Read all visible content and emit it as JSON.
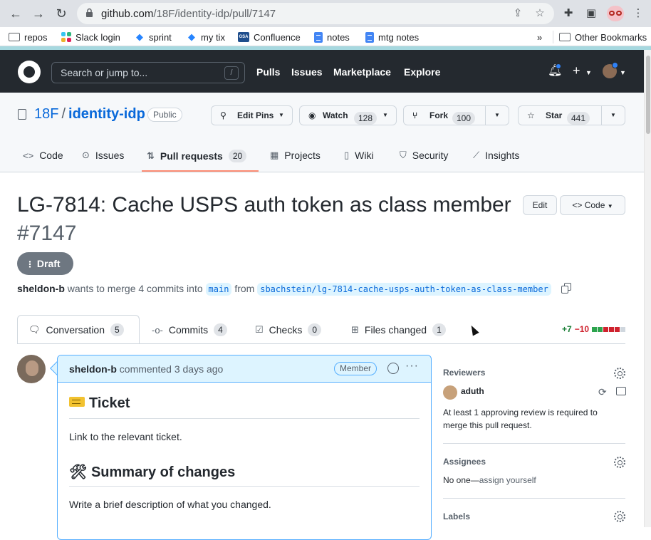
{
  "browser": {
    "url_host": "github.com",
    "url_path": "/18F/identity-idp/pull/7147",
    "bookmarks": [
      {
        "label": "repos",
        "icon": "folder-icon"
      },
      {
        "label": "Slack login",
        "icon": "slack-icon"
      },
      {
        "label": "sprint",
        "icon": "jira-icon"
      },
      {
        "label": "my tix",
        "icon": "jira-icon"
      },
      {
        "label": "Confluence",
        "icon": "gsa-icon"
      },
      {
        "label": "notes",
        "icon": "doc-icon"
      },
      {
        "label": "mtg notes",
        "icon": "doc-icon"
      }
    ],
    "overflow": "»",
    "other_bookmarks": "Other Bookmarks"
  },
  "github_header": {
    "search_placeholder": "Search or jump to...",
    "search_shortcut": "/",
    "nav": [
      "Pulls",
      "Issues",
      "Marketplace",
      "Explore"
    ]
  },
  "repo": {
    "owner": "18F",
    "separator": "/",
    "name": "identity-idp",
    "visibility": "Public",
    "edit_pins": "Edit Pins",
    "watch_label": "Watch",
    "watch_count": "128",
    "fork_label": "Fork",
    "fork_count": "100",
    "star_label": "Star",
    "star_count": "441",
    "tabs": [
      {
        "label": "Code",
        "icon": "code-icon"
      },
      {
        "label": "Issues",
        "icon": "issue-icon"
      },
      {
        "label": "Pull requests",
        "icon": "pull-request-icon",
        "count": "20",
        "selected": true
      },
      {
        "label": "Projects",
        "icon": "table-icon"
      },
      {
        "label": "Wiki",
        "icon": "book-icon"
      },
      {
        "label": "Security",
        "icon": "shield-icon"
      },
      {
        "label": "Insights",
        "icon": "graph-icon"
      }
    ]
  },
  "pr": {
    "title": "LG-7814: Cache USPS auth token as class member",
    "number": "#7147",
    "edit_label": "Edit",
    "code_label": "Code",
    "state": "Draft",
    "author": "sheldon-b",
    "meta_text": "wants to merge 4 commits into",
    "base_branch": "main",
    "from_text": "from",
    "head_branch": "sbachstein/lg-7814-cache-usps-auth-token-as-class-member",
    "tabs": [
      {
        "label": "Conversation",
        "count": "5",
        "icon": "comment-discussion-icon"
      },
      {
        "label": "Commits",
        "count": "4",
        "icon": "git-commit-icon"
      },
      {
        "label": "Checks",
        "count": "0",
        "icon": "checklist-icon"
      },
      {
        "label": "Files changed",
        "count": "1",
        "icon": "file-diff-icon"
      }
    ],
    "additions": "+7",
    "deletions": "−10",
    "diffstat_boxes": [
      "#2da44e",
      "#2da44e",
      "#cf222e",
      "#cf222e",
      "#cf222e",
      "#d0d7de"
    ]
  },
  "comment": {
    "author": "sheldon-b",
    "action": "commented 3 days ago",
    "role": "Member",
    "heading1": "Ticket",
    "para1": "Link to the relevant ticket.",
    "heading2_emoji": "🛠",
    "heading2": "Summary of changes",
    "para2": "Write a brief description of what you changed."
  },
  "sidebar": {
    "reviewers_label": "Reviewers",
    "reviewer_name": "aduth",
    "review_note_line1": "At least 1 approving review is required to",
    "review_note_line2": "merge this pull request.",
    "assignees_label": "Assignees",
    "assignees_none": "No one—",
    "assign_yourself": "assign yourself",
    "labels_label": "Labels"
  },
  "colors": {
    "header_bg": "#24292f",
    "link": "#0969da",
    "underline": "#fd8c73",
    "draft": "#6e7781"
  }
}
